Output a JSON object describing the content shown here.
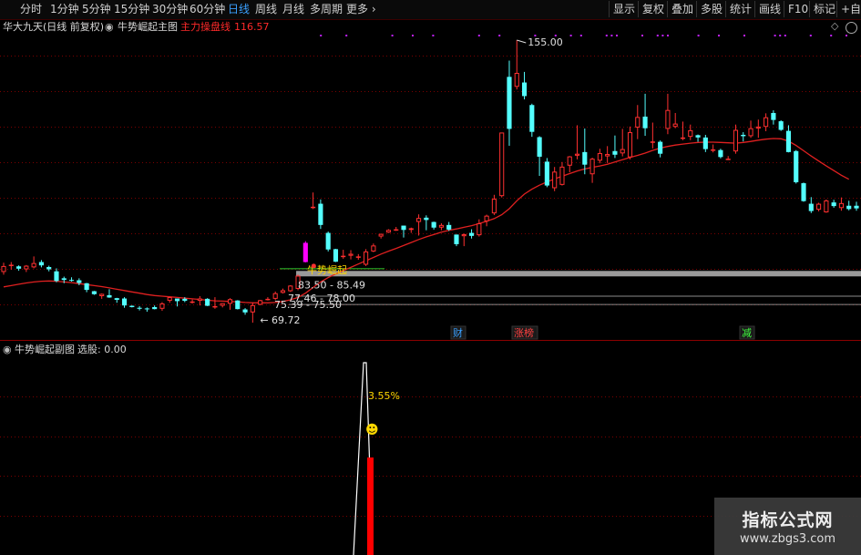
{
  "toolbar": {
    "periods": [
      "分时",
      "1分钟",
      "5分钟",
      "15分钟",
      "30分钟",
      "60分钟",
      "日线",
      "周线",
      "月线",
      "多周期",
      "更多"
    ],
    "active_period": "日线",
    "more_arrow": "›",
    "right_buttons": [
      "显示",
      "复权",
      "叠加",
      "多股",
      "统计",
      "画线",
      "F10",
      "标记",
      "+自选"
    ]
  },
  "main_header": {
    "stock": "华大九天(日线 前复权)",
    "indicator": "牛势崛起主图",
    "line_name": "主力操盘线",
    "line_value": "116.57"
  },
  "main_chart": {
    "price_labels": {
      "high": "155.00",
      "low": "69.72",
      "zone1": "83.50 - 85.49",
      "zone2": "77.46 - 78.00",
      "zone3": "75.39 - 75.50"
    },
    "signal_text": "牛势崛起",
    "event_badges": [
      {
        "text": "财",
        "color": "#3aa0ff"
      },
      {
        "text": "涨榜",
        "color": "#ff4040"
      },
      {
        "text": "减",
        "color": "#40ff40"
      }
    ],
    "colors": {
      "up": "#ff3030",
      "down": "#54ffff",
      "ma": "#e02020",
      "signal_bar": "#ff00ff",
      "marker": "#c020ff"
    },
    "candles": [
      [
        85.0,
        87.8,
        84.2,
        86.8
      ],
      [
        86.9,
        88.0,
        85.7,
        87.2
      ],
      [
        86.7,
        87.0,
        85.4,
        86.0
      ],
      [
        85.8,
        87.1,
        85.0,
        86.9
      ],
      [
        86.4,
        89.7,
        86.1,
        87.7
      ],
      [
        88.0,
        88.6,
        86.4,
        87.0
      ],
      [
        86.5,
        86.9,
        85.2,
        85.8
      ],
      [
        85.2,
        86.1,
        81.9,
        82.3
      ],
      [
        83.1,
        83.6,
        81.6,
        82.6
      ],
      [
        82.6,
        83.4,
        82.1,
        82.5
      ],
      [
        82.5,
        83.1,
        81.0,
        81.7
      ],
      [
        81.6,
        81.7,
        78.9,
        79.6
      ],
      [
        79.2,
        79.3,
        78.1,
        78.3
      ],
      [
        77.7,
        78.5,
        76.9,
        78.4
      ],
      [
        78.0,
        79.8,
        77.2,
        77.3
      ],
      [
        77.1,
        77.2,
        75.7,
        76.6
      ],
      [
        77.0,
        77.4,
        74.2,
        74.9
      ],
      [
        74.8,
        74.9,
        74.3,
        74.4
      ],
      [
        74.2,
        74.7,
        73.4,
        73.9
      ],
      [
        74.0,
        74.3,
        73.0,
        73.9
      ],
      [
        74.4,
        74.9,
        73.7,
        73.8
      ],
      [
        73.9,
        75.9,
        73.3,
        75.5
      ],
      [
        76.3,
        77.5,
        75.7,
        77.4
      ],
      [
        77.0,
        77.0,
        74.6,
        76.2
      ],
      [
        76.9,
        77.4,
        75.9,
        76.3
      ],
      [
        75.9,
        76.7,
        75.5,
        76.1
      ],
      [
        76.3,
        77.7,
        74.9,
        77.0
      ],
      [
        76.9,
        77.1,
        74.7,
        74.8
      ],
      [
        74.5,
        77.4,
        73.9,
        74.7
      ],
      [
        74.8,
        75.6,
        74.3,
        75.6
      ],
      [
        75.4,
        77.1,
        73.6,
        76.8
      ],
      [
        76.4,
        76.5,
        73.7,
        73.8
      ],
      [
        73.7,
        74.1,
        72.1,
        72.8
      ],
      [
        72.8,
        75.8,
        69.7,
        75.0
      ],
      [
        75.1,
        76.6,
        75.0,
        76.5
      ],
      [
        76.5,
        77.4,
        76.4,
        76.9
      ],
      [
        76.9,
        79.1,
        76.5,
        78.6
      ],
      [
        78.7,
        80.0,
        78.5,
        79.5
      ],
      [
        79.2,
        81.0,
        79.0,
        80.9
      ],
      [
        79.9,
        84.2,
        79.5,
        83.9
      ],
      [
        88.0,
        94.3,
        87.9,
        93.8
      ],
      [
        104.3,
        109.0,
        104.0,
        104.7
      ],
      [
        105.6,
        106.9,
        98.0,
        99.2
      ],
      [
        96.8,
        97.2,
        91.2,
        91.8
      ],
      [
        91.9,
        92.0,
        88.0,
        88.1
      ],
      [
        89.8,
        91.7,
        89.0,
        89.9
      ],
      [
        89.9,
        91.6,
        88.8,
        90.5
      ],
      [
        89.5,
        90.4,
        88.7,
        89.7
      ],
      [
        87.2,
        91.9,
        86.8,
        91.2
      ],
      [
        91.2,
        93.6,
        91.0,
        93.0
      ],
      [
        95.7,
        96.6,
        95.1,
        96.5
      ],
      [
        96.9,
        97.9,
        96.8,
        97.7
      ],
      [
        97.7,
        98.6,
        97.4,
        97.9
      ],
      [
        99.0,
        99.0,
        95.4,
        97.7
      ],
      [
        97.7,
        98.4,
        96.8,
        98.2
      ],
      [
        100.1,
        102.4,
        96.0,
        101.3
      ],
      [
        101.4,
        102.1,
        97.6,
        100.7
      ],
      [
        100.1,
        100.2,
        97.8,
        98.4
      ],
      [
        98.4,
        99.7,
        97.6,
        99.2
      ],
      [
        99.2,
        100.1,
        97.4,
        97.8
      ],
      [
        96.3,
        96.3,
        92.8,
        93.4
      ],
      [
        95.8,
        96.6,
        92.8,
        96.4
      ],
      [
        96.8,
        97.9,
        95.1,
        95.9
      ],
      [
        96.1,
        100.9,
        95.7,
        99.7
      ],
      [
        100.3,
        102.3,
        98.8,
        102.0
      ],
      [
        102.7,
        108.3,
        102.2,
        107.1
      ],
      [
        107.9,
        127.0,
        107.5,
        127.1
      ],
      [
        143.9,
        148.8,
        123.1,
        128.2
      ],
      [
        140.9,
        155.0,
        140.1,
        145.1
      ],
      [
        142.2,
        145.4,
        137.1,
        138.1
      ],
      [
        135.4,
        135.8,
        125.8,
        127.3
      ],
      [
        125.7,
        126.0,
        114.0,
        119.8
      ],
      [
        118.3,
        119.4,
        110.6,
        111.1
      ],
      [
        110.3,
        116.7,
        109.4,
        115.3
      ],
      [
        111.3,
        118.2,
        111.1,
        116.8
      ],
      [
        117.1,
        120.0,
        115.1,
        119.9
      ],
      [
        120.1,
        129.3,
        119.0,
        120.7
      ],
      [
        121.2,
        128.3,
        114.5,
        117.4
      ],
      [
        114.5,
        119.5,
        111.9,
        119.2
      ],
      [
        118.6,
        122.2,
        117.8,
        120.9
      ],
      [
        119.9,
        123.0,
        117.9,
        120.6
      ],
      [
        121.5,
        126.2,
        119.4,
        120.4
      ],
      [
        120.8,
        128.2,
        119.9,
        122.1
      ],
      [
        119.6,
        128.9,
        119.0,
        127.2
      ],
      [
        128.6,
        135.4,
        125.1,
        131.8
      ],
      [
        131.9,
        138.8,
        126.1,
        128.4
      ],
      [
        124.0,
        130.1,
        122.3,
        124.4
      ],
      [
        124.3,
        124.7,
        119.6,
        120.7
      ],
      [
        128.2,
        138.8,
        126.6,
        133.9
      ],
      [
        128.8,
        133.0,
        128.4,
        129.8
      ],
      [
        125.3,
        130.4,
        124.8,
        125.6
      ],
      [
        125.8,
        129.5,
        124.8,
        127.8
      ],
      [
        126.3,
        126.5,
        124.3,
        125.6
      ],
      [
        125.6,
        126.4,
        121.2,
        122.1
      ],
      [
        121.7,
        123.5,
        121.1,
        122.0
      ],
      [
        121.8,
        122.2,
        119.3,
        119.7
      ],
      [
        119.1,
        120.0,
        118.8,
        119.2
      ],
      [
        121.4,
        129.5,
        120.7,
        127.9
      ],
      [
        126.4,
        127.2,
        124.4,
        126.0
      ],
      [
        126.0,
        130.7,
        125.5,
        128.4
      ],
      [
        128.3,
        131.0,
        125.5,
        128.9
      ],
      [
        128.8,
        132.9,
        127.5,
        131.7
      ],
      [
        133.0,
        133.8,
        129.5,
        130.9
      ],
      [
        130.5,
        130.8,
        127.6,
        127.9
      ],
      [
        127.6,
        129.3,
        121.1,
        121.2
      ],
      [
        121.5,
        121.8,
        111.7,
        112.1
      ],
      [
        111.8,
        112.0,
        106.2,
        106.4
      ],
      [
        105.6,
        107.6,
        102.8,
        103.4
      ],
      [
        103.8,
        105.9,
        103.3,
        105.6
      ],
      [
        103.0,
        106.9,
        102.9,
        106.6
      ],
      [
        106.0,
        106.8,
        104.4,
        104.9
      ],
      [
        104.3,
        107.5,
        103.5,
        105.8
      ],
      [
        105.0,
        106.5,
        103.6,
        104.0
      ],
      [
        105.0,
        106.2,
        103.5,
        104.2
      ]
    ],
    "ma": [
      80.5,
      80.9,
      81.3,
      81.7,
      82.0,
      82.2,
      82.3,
      82.2,
      82.0,
      81.8,
      81.5,
      81.2,
      80.9,
      80.6,
      80.2,
      79.8,
      79.4,
      79.0,
      78.6,
      78.2,
      77.9,
      77.7,
      77.5,
      77.3,
      77.1,
      76.9,
      76.7,
      76.5,
      76.3,
      76.2,
      76.1,
      76.0,
      75.8,
      75.7,
      75.7,
      75.7,
      75.8,
      76.1,
      76.6,
      77.3,
      78.6,
      80.3,
      82.0,
      83.3,
      84.4,
      85.4,
      86.4,
      87.4,
      88.4,
      89.4,
      90.4,
      91.3,
      92.1,
      93.0,
      93.9,
      94.8,
      95.6,
      96.3,
      97.0,
      97.6,
      98.0,
      98.5,
      99.0,
      99.6,
      100.3,
      101.1,
      102.3,
      104.1,
      106.5,
      108.5,
      110.0,
      111.2,
      112.2,
      113.1,
      113.9,
      114.7,
      115.5,
      116.1,
      116.6,
      117.0,
      117.5,
      118.2,
      118.9,
      119.6,
      120.2,
      120.9,
      121.7,
      122.4,
      122.9,
      123.3,
      123.6,
      123.9,
      124.1,
      124.2,
      124.2,
      124.1,
      124.0,
      123.9,
      124.1,
      124.4,
      124.8,
      125.1,
      125.3,
      125.2,
      124.5,
      123.2,
      121.6,
      120.0,
      118.5,
      117.0,
      115.6,
      114.2,
      113.0
    ],
    "signal_index": 39,
    "signal_highlight_index": 40,
    "pink_bar_index": 40,
    "star_indices": [
      62,
      67,
      76,
      80,
      84,
      93,
      97,
      104,
      108,
      111,
      113,
      118,
      119,
      120,
      125,
      128,
      129,
      130,
      136,
      140,
      145,
      151,
      152,
      153,
      158,
      162,
      165
    ],
    "pivot_index": 68
  },
  "sub_header": {
    "indicator": "牛势崛起副图",
    "selection_label": "选股: 0.00"
  },
  "sub_chart": {
    "pct_label": "3.55%",
    "smiley": "☻",
    "colors": {
      "line": "#ffffff",
      "bar": "#ff0000",
      "pct": "#ffd700",
      "smiley": "#ffd700"
    }
  },
  "watermark": {
    "title": "指标公式网",
    "url": "www.zbgs3.com"
  }
}
